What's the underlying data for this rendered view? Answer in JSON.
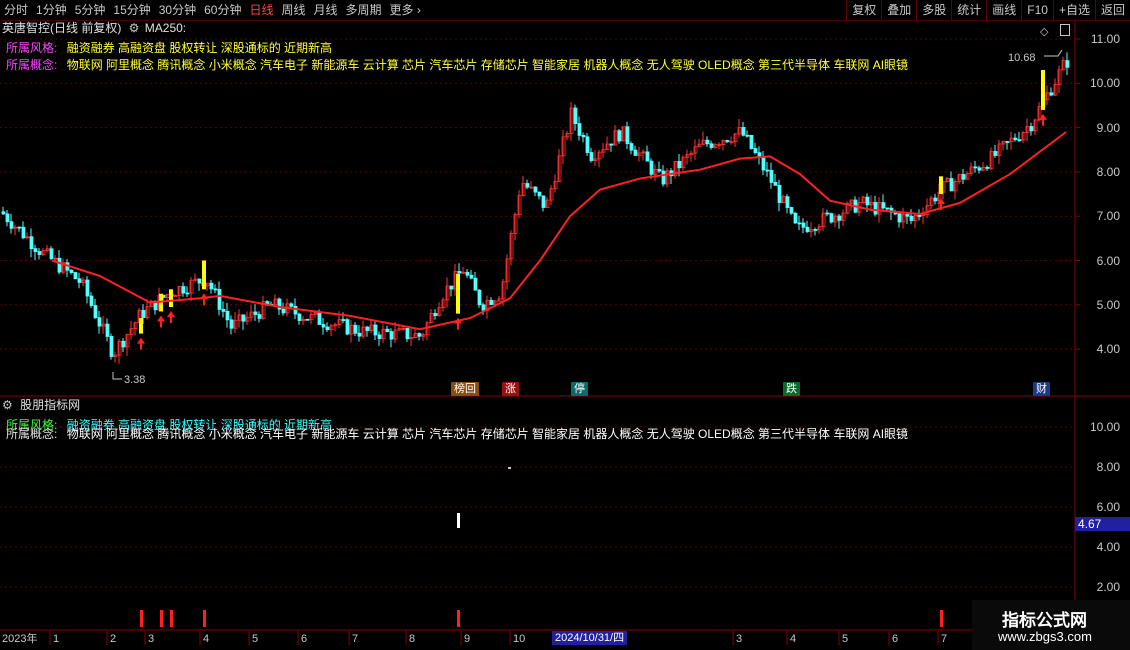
{
  "toolbar": {
    "items": [
      "分时",
      "1分钟",
      "5分钟",
      "15分钟",
      "30分钟",
      "60分钟",
      "日线",
      "周线",
      "月线",
      "多周期",
      "更多"
    ],
    "active_index": 6,
    "right_buttons": [
      "复权",
      "叠加",
      "多股",
      "统计",
      "画线",
      "F10",
      "+自选",
      "返回"
    ]
  },
  "chart_header": {
    "title": "英唐智控(日线 前复权)",
    "ma_label": "MA250:"
  },
  "upper_info": {
    "style_label": "所属风格:",
    "style_value": "融资融券 高融资盘 股权转让 深股通标的 近期新高",
    "concept_label": "所属概念:",
    "concept_value": "物联网 阿里概念 腾讯概念 小米概念 汽车电子 新能源车 云计算 芯片 汽车芯片 存储芯片 智能家居 机器人概念 无人驾驶 OLED概念 第三代半导体 车联网 AI眼镜"
  },
  "price_axis": [
    "11.00",
    "10.00",
    "9.00",
    "8.00",
    "7.00",
    "6.00",
    "5.00",
    "4.00"
  ],
  "annotations": {
    "low": "3.38",
    "high": "10.68"
  },
  "event_tags": [
    {
      "text": "榜回",
      "color": "#8a4a10"
    },
    {
      "text": "涨",
      "color": "#9a1010"
    },
    {
      "text": "停",
      "color": "#0a6a6a"
    },
    {
      "text": "跌",
      "color": "#0a6a2a"
    },
    {
      "text": "财",
      "color": "#1a3a8a"
    }
  ],
  "lower_panel": {
    "title": "股朋指标网",
    "style_label": "所属风格:",
    "style_value": "融资融券 高融资盘 股权转让 深股通标的 近期新高",
    "concept_label": "所属概念:",
    "concept_value": "物联网 阿里概念 腾讯概念 小米概念 汽车电子 新能源车 云计算 芯片 汽车芯片 存储芯片 智能家居 机器人概念 无人驾驶 OLED概念 第三代半导体 车联网 AI眼镜",
    "axis": [
      "10.00",
      "8.00",
      "6.00",
      "4.00",
      "2.00"
    ],
    "current_value": "4.67"
  },
  "timeline": {
    "year": "2023年",
    "months": [
      "1",
      "2",
      "3",
      "4",
      "5",
      "6",
      "7",
      "8",
      "9",
      "10",
      "3",
      "4",
      "5",
      "6",
      "7"
    ],
    "highlight": "2024/10/31/四"
  },
  "watermark": {
    "title": "指标公式网",
    "url": "www.zbgs3.com"
  },
  "colors": {
    "ma_line": "#ff2020",
    "up_candle": "#ff3333",
    "down_candle": "#54ffff",
    "signal": "#ffff00",
    "grid": "#5a0000",
    "style_label": "#ff44ff",
    "info_text": "#ffff33"
  }
}
